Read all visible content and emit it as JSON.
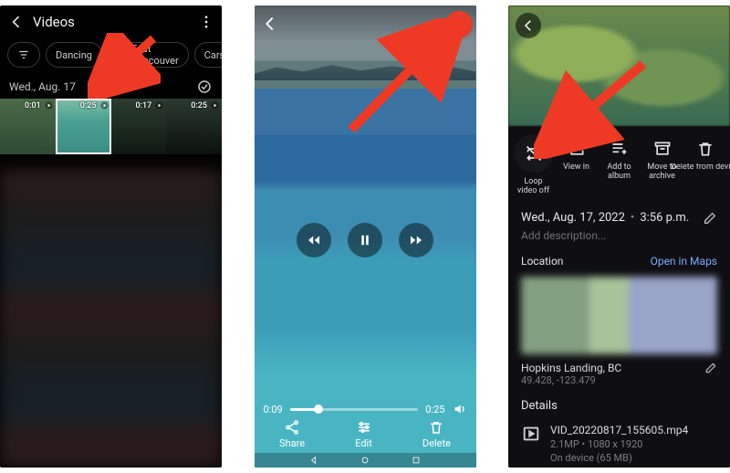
{
  "left": {
    "title": "Videos",
    "chips": {
      "filter_icon": "filter-icon",
      "chip1": "Dancing",
      "chip2_icon": "location-icon",
      "chip2": "East Vancouver",
      "chip3": "Cars"
    },
    "date": "Wed., Aug. 17",
    "thumbs": [
      {
        "duration": "0:01"
      },
      {
        "duration": "0:25"
      },
      {
        "duration": "0:17"
      },
      {
        "duration": "0:25"
      }
    ]
  },
  "middle": {
    "time_elapsed": "0:09",
    "time_total": "0:25",
    "actions": {
      "share": "Share",
      "edit": "Edit",
      "delete": "Delete"
    }
  },
  "right": {
    "actions": {
      "loop": "Loop video off",
      "view": "View in",
      "album": "Add to album",
      "archive": "Move to archive",
      "delete": "Delete from device"
    },
    "date": "Wed., Aug. 17, 2022",
    "time": "3:56 p.m.",
    "add_desc": "Add description...",
    "location_label": "Location",
    "open_maps": "Open in Maps",
    "place": "Hopkins Landing, BC",
    "coords": "49.428, -123.479",
    "details_label": "Details",
    "file": {
      "name": "VID_20220817_155605.mp4",
      "meta": "2.1MP  •  1080 x 1920",
      "device": "On device (65 MB)"
    }
  }
}
